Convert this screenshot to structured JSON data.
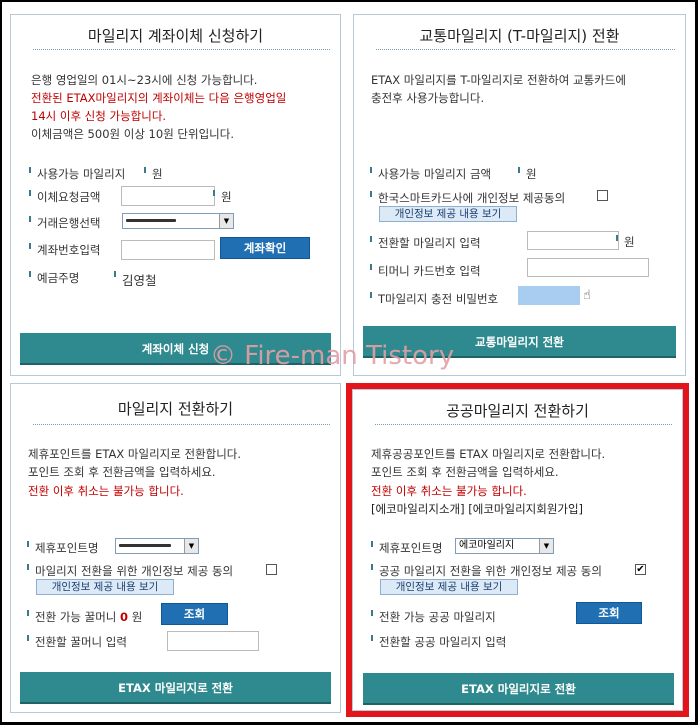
{
  "watermark": "© Fire-man Tistory",
  "panel1": {
    "title": "마일리지 계좌이체 신청하기",
    "desc1": "은행 영업일의 01시~23시에 신청 가능합니다.",
    "desc2": "전환된 ETAX마일리지의 계좌이체는 다음 은행영업일",
    "desc3": "14시 이후 신청 가능합니다.",
    "desc4": "이체금액은 500원 이상 10원 단위입니다.",
    "available_label": "사용가능 마일리지",
    "available_unit": "원",
    "amount_label": "이체요청금액",
    "amount_unit": "원",
    "bank_label": "거래은행선택",
    "account_label": "계좌번호입력",
    "account_check_button": "계좌확인",
    "holder_label": "예금주명",
    "holder_value": "김영철",
    "submit_button": "계좌이체 신청"
  },
  "panel2": {
    "title": "교통마일리지 (T-마일리지) 전환",
    "desc1": "ETAX 마일리지를 T-마일리지로 전환하여 교통카드에",
    "desc2": "충전후 사용가능합니다.",
    "available_label": "사용가능 마일리지 금액",
    "available_unit": "원",
    "consent_label": "한국스마트카드사에 개인정보 제공동의",
    "consent_view_button": "개인정보 제공 내용 보기",
    "convert_amount_label": "전환할 마일리지 입력",
    "convert_amount_unit": "원",
    "card_number_label": "티머니 카드번호 입력",
    "password_label": "T마일리지 충전 비밀번호",
    "submit_button": "교통마일리지 전환"
  },
  "panel3": {
    "title": "마일리지 전환하기",
    "desc1": "제휴포인트를 ETAX 마일리지로 전환합니다.",
    "desc2": "포인트 조회 후 전환금액을 입력하세요.",
    "desc3": "전환 이후 취소는 불가능 합니다.",
    "partner_label": "제휴포인트명",
    "consent_label": "마일리지 전환을 위한 개인정보 제공 동의",
    "consent_view_button": "개인정보 제공 내용 보기",
    "available_label": "전환 가능 꿀머니",
    "available_value": "0",
    "available_unit": "원",
    "lookup_button": "조회",
    "convert_label": "전환할 꿀머니 입력",
    "submit_button": "ETAX 마일리지로 전환"
  },
  "panel4": {
    "title": "공공마일리지 전환하기",
    "desc1": "제휴공공포인트를 ETAX 마일리지로 전환합니다.",
    "desc2": "포인트 조회 후 전환금액을 입력하세요.",
    "desc3": "전환 이후 취소는 불가능 합니다.",
    "links": "[에코마일리지소개] [에코마일리지회원가입]",
    "partner_label": "제휴포인트명",
    "partner_selected": "에코마일리지",
    "consent_label": "공공 마일리지 전환을 위한 개인정보 제공 동의",
    "consent_checked": "✔",
    "consent_view_button": "개인정보 제공 내용 보기",
    "available_label": "전환 가능 공공 마일리지",
    "lookup_button": "조회",
    "convert_label": "전환할 공공 마일리지 입력",
    "submit_button": "ETAX 마일리지로 전환"
  },
  "colors": {
    "accent_teal": "#2f8a8f",
    "button_blue": "#1f6fb2",
    "warning_red": "#c00000",
    "highlight_red": "#e3151b"
  }
}
